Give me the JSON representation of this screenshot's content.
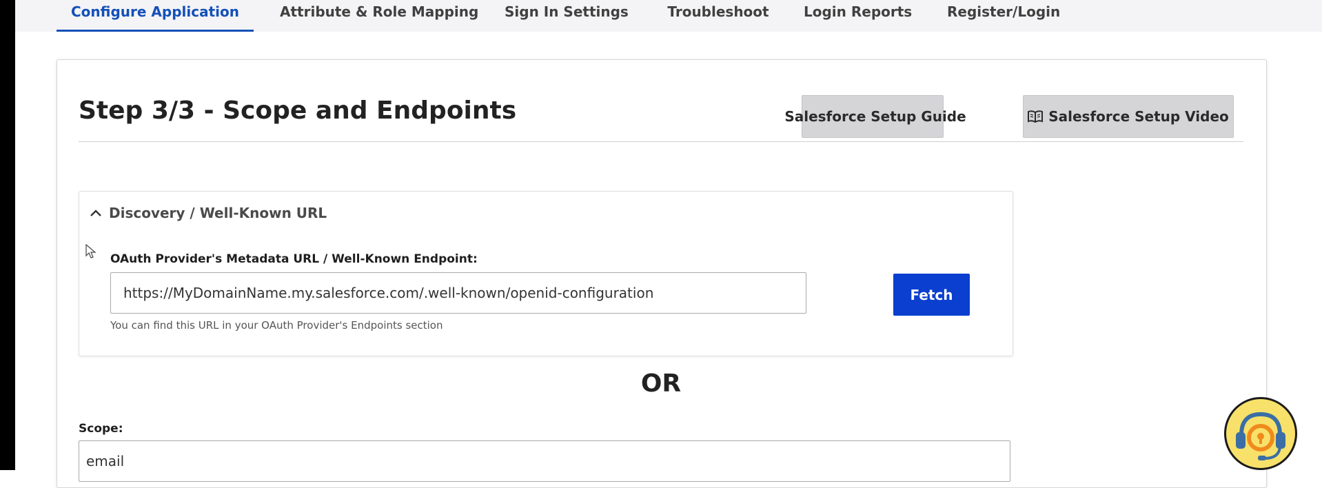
{
  "tabs": [
    {
      "label": "Configure Application",
      "active": true
    },
    {
      "label": "Attribute & Role Mapping",
      "active": false
    },
    {
      "label": "Sign In Settings",
      "active": false
    },
    {
      "label": "Troubleshoot",
      "active": false
    },
    {
      "label": "Login Reports",
      "active": false
    },
    {
      "label": "Register/Login",
      "active": false
    }
  ],
  "page": {
    "title": "Step 3/3 - Scope and Endpoints",
    "guide_button": {
      "icon": "book-icon",
      "label": "Salesforce Setup Guide"
    },
    "video_button": {
      "icon": "book-icon",
      "label": "Salesforce Setup Video"
    }
  },
  "discovery": {
    "title": "Discovery / Well-Known URL",
    "expanded": true,
    "field_label": "OAuth Provider's Metadata URL / Well-Known Endpoint:",
    "url_value": "https://MyDomainName.my.salesforce.com/.well-known/openid-configuration",
    "help_text": "You can find this URL in your OAuth Provider's Endpoints section",
    "fetch_label": "Fetch"
  },
  "separator": "OR",
  "scope": {
    "label": "Scope:",
    "value": "email"
  },
  "colors": {
    "accent": "#1450b8",
    "fetch_button": "#0a3fcf",
    "support_widget": "#f7e16a"
  },
  "support_widget": {
    "icon": "headset-support-icon"
  }
}
